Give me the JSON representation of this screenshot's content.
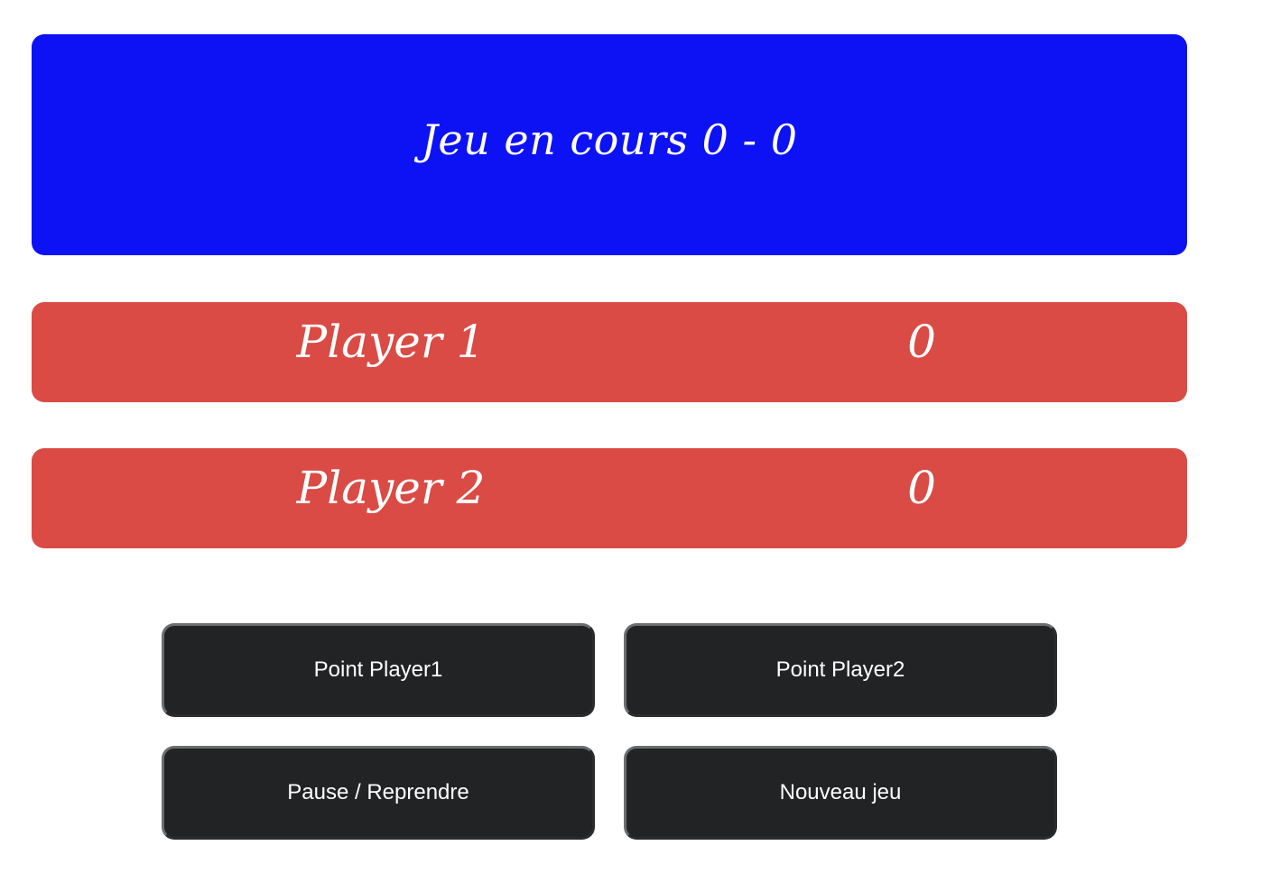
{
  "banner": {
    "text": "Jeu en cours 0 - 0",
    "color": "#0d12f5"
  },
  "players": [
    {
      "name": "Player 1",
      "score": "0"
    },
    {
      "name": "Player 2",
      "score": "0"
    }
  ],
  "player_row_color": "#d94b44",
  "buttons": {
    "point_player1": "Point Player1",
    "point_player2": "Point Player2",
    "pause_resume": "Pause / Reprendre",
    "new_game": "Nouveau jeu",
    "color": "#222325"
  }
}
